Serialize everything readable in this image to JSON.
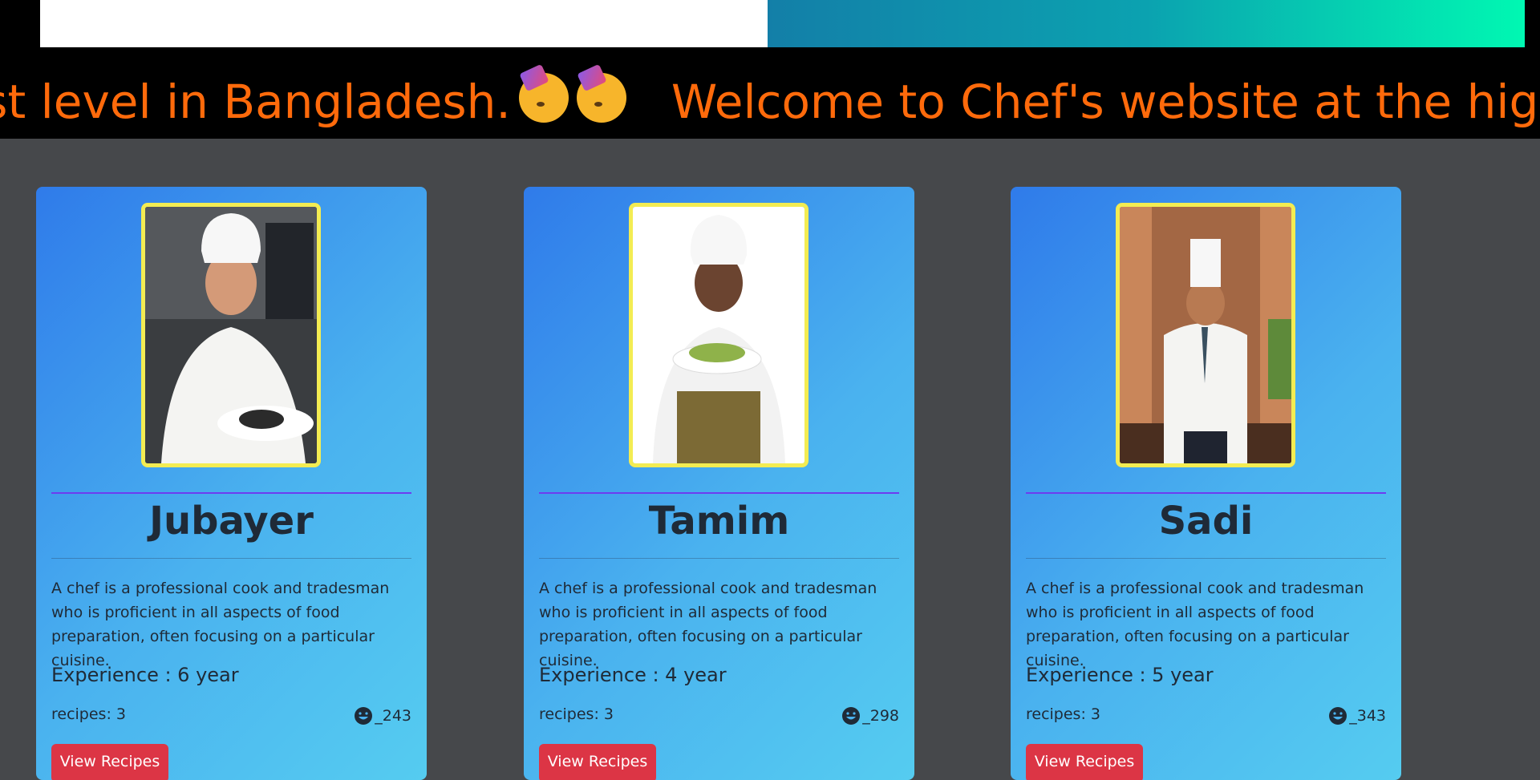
{
  "marquee": {
    "text_left": "ghest level in Bangladesh.",
    "text_right": "Welcome to Chef's website at the hig"
  },
  "chefs": [
    {
      "name": "Jubayer",
      "description": "A chef is a professional cook and tradesman who is proficient in all aspects of food preparation, often focusing on a particular cuisine.",
      "experience": "Experience : 6 year",
      "recipes": "recipes: 3",
      "likes": "_243",
      "button": "View Recipes"
    },
    {
      "name": "Tamim",
      "description": "A chef is a professional cook and tradesman who is proficient in all aspects of food preparation, often focusing on a particular cuisine.",
      "experience": "Experience : 4 year",
      "recipes": "recipes: 3",
      "likes": "_298",
      "button": "View Recipes"
    },
    {
      "name": "Sadi",
      "description": "A chef is a professional cook and tradesman who is proficient in all aspects of food preparation, often focusing on a particular cuisine.",
      "experience": "Experience : 5 year",
      "recipes": "recipes: 3",
      "likes": "_343",
      "button": "View Recipes"
    }
  ],
  "icons": {
    "likes": "smiley-face-icon",
    "marquee": "partying-face-icon"
  },
  "colors": {
    "marquee_text": "#ff6a0b",
    "photo_border": "#f3ec52",
    "button": "#dc3545",
    "page_bg": "#46484b"
  }
}
